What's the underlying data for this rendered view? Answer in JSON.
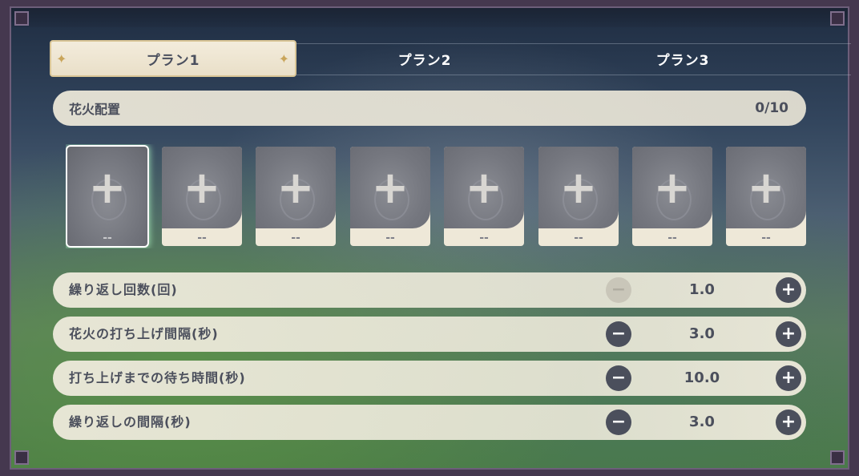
{
  "tabs": [
    {
      "label": "プラン1",
      "active": true
    },
    {
      "label": "プラン2",
      "active": false
    },
    {
      "label": "プラン3",
      "active": false
    }
  ],
  "fireworks": {
    "title": "花火配置",
    "count": "0/10"
  },
  "slots": [
    {
      "label": "--",
      "selected": true
    },
    {
      "label": "--",
      "selected": false
    },
    {
      "label": "--",
      "selected": false
    },
    {
      "label": "--",
      "selected": false
    },
    {
      "label": "--",
      "selected": false
    },
    {
      "label": "--",
      "selected": false
    },
    {
      "label": "--",
      "selected": false
    },
    {
      "label": "--",
      "selected": false
    }
  ],
  "settings": [
    {
      "label": "繰り返し回数(回)",
      "value": "1.0",
      "minus_enabled": false
    },
    {
      "label": "花火の打ち上げ間隔(秒)",
      "value": "3.0",
      "minus_enabled": true
    },
    {
      "label": "打ち上げまでの待ち時間(秒)",
      "value": "10.0",
      "minus_enabled": true
    },
    {
      "label": "繰り返しの間隔(秒)",
      "value": "3.0",
      "minus_enabled": true
    }
  ],
  "icons": {
    "plus": "+",
    "minus": "−",
    "star": "✦"
  }
}
